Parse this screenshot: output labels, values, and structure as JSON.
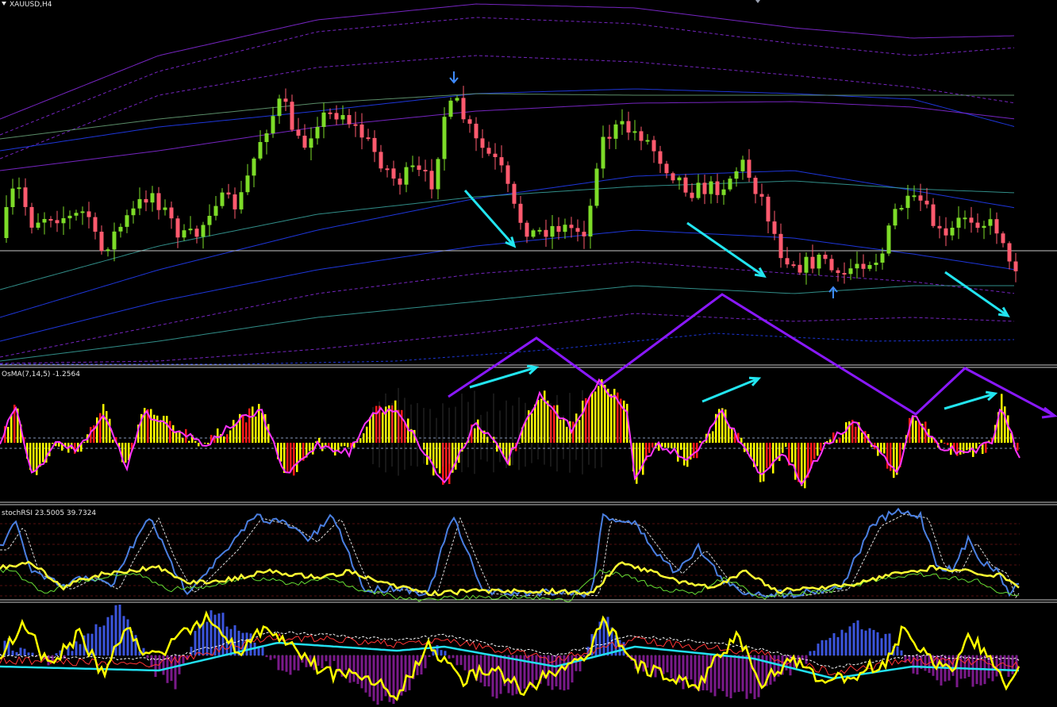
{
  "window": {
    "symbol_timeframe": "XAUUSD,H4"
  },
  "panes": {
    "osma": {
      "label": "OsMA(7,14,5) -1.2564"
    },
    "stochrsi": {
      "label": "stochRSI 23.5005 39.7324"
    }
  },
  "colors": {
    "background": "#000000",
    "bull_candle": "#7ddc28",
    "bear_candle": "#ff5a6e",
    "envelope_purple": "#8a2be2",
    "envelope_blue": "#2340ff",
    "envelope_teal": "#3aa6a0",
    "annotation_cyan": "#22e5f0",
    "annotation_violet": "#8a18ff",
    "osma_yellow": "#ffff00",
    "osma_red": "#ff1a1a",
    "osma_line": "#ff33ff",
    "stoch_blue": "#4a7fe0",
    "stoch_yellow": "#ffff33",
    "stoch_green": "#66dd33",
    "pane4_blue_hist": "#3b55dd",
    "pane4_purple_hist": "#7a1a8a",
    "pane4_yellow": "#ffff00",
    "pane4_cyan": "#22e0f0",
    "pane4_red": "#ff3333",
    "price_line": "#c8c8c8",
    "separator": "#c8c8c8"
  },
  "icons": {
    "arrow_down_signal": "arrow-down-signal-icon",
    "arrow_up_signal": "arrow-up-signal-icon",
    "pane_menu": "triangle-down-icon"
  }
}
